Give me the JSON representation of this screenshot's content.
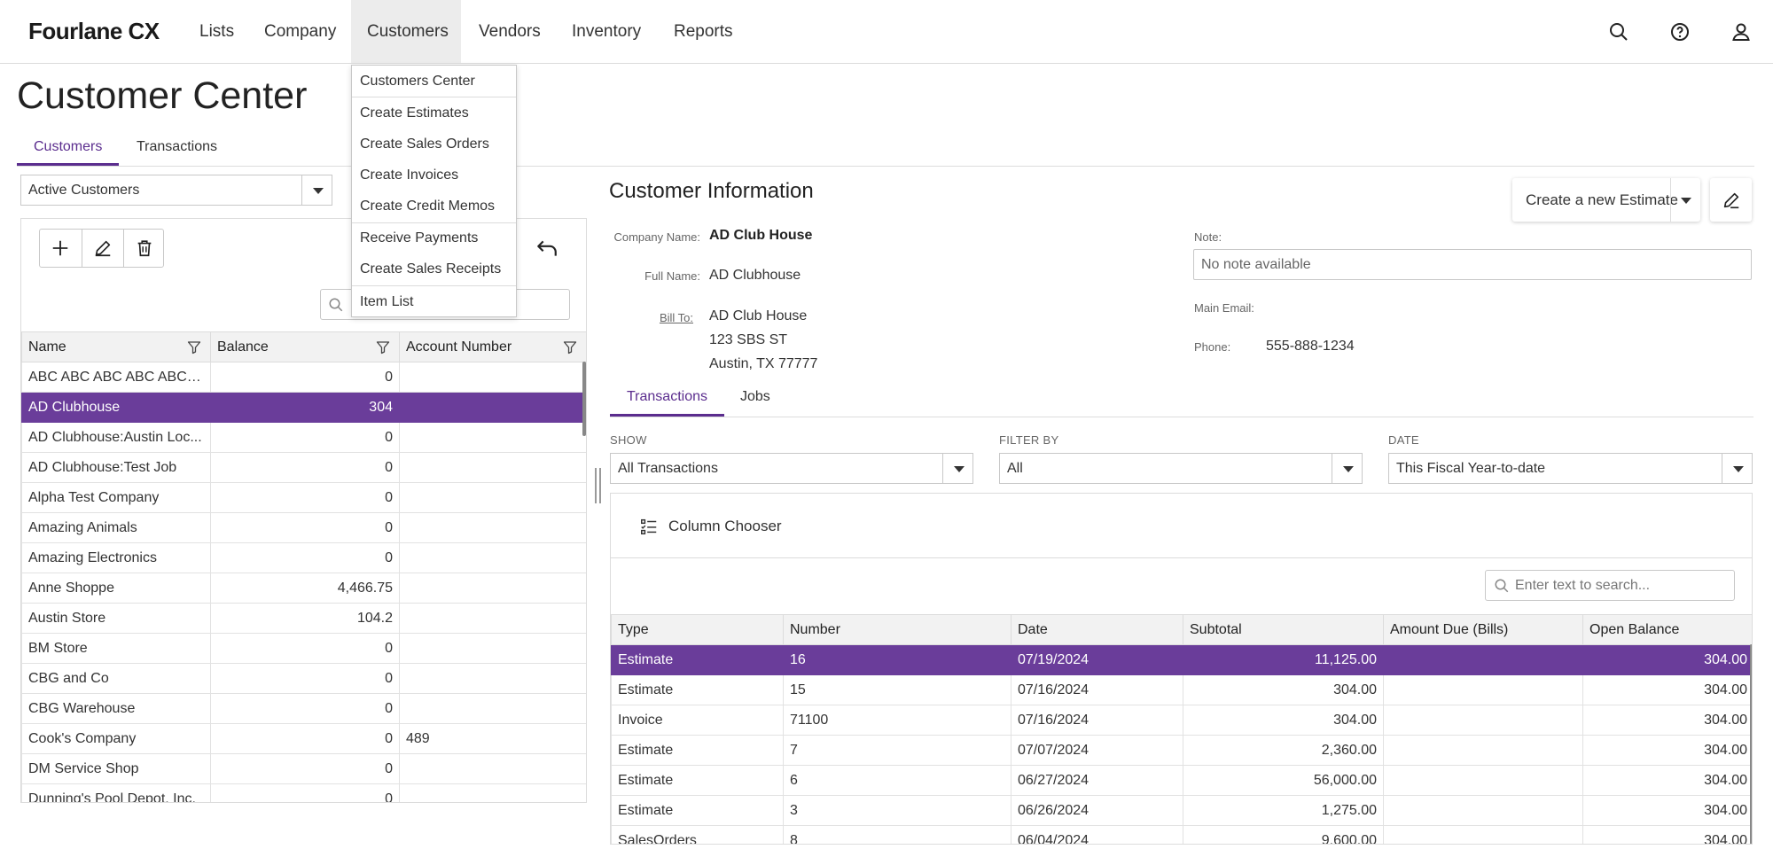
{
  "app": {
    "logo": "Fourlane CX"
  },
  "nav": {
    "items": [
      "Lists",
      "Company",
      "Customers",
      "Vendors",
      "Inventory",
      "Reports"
    ],
    "active": "Customers",
    "icons": [
      "search-icon",
      "help-icon",
      "user-icon"
    ]
  },
  "customers_menu": {
    "items": [
      "Customers Center",
      "Create Estimates",
      "Create Sales Orders",
      "Create Invoices",
      "Create Credit Memos",
      "Receive Payments",
      "Create Sales Receipts",
      "Item List"
    ]
  },
  "page": {
    "title": "Customer Center",
    "tabs": [
      "Customers",
      "Transactions"
    ],
    "active_tab": "Customers"
  },
  "left": {
    "filter_value": "Active Customers",
    "columns": [
      "Name",
      "Balance",
      "Account Number"
    ],
    "rows": [
      [
        "ABC ABC ABC ABC ABC A...",
        "0",
        ""
      ],
      [
        "AD Clubhouse",
        "304",
        ""
      ],
      [
        "AD Clubhouse:Austin Loc...",
        "0",
        ""
      ],
      [
        "AD Clubhouse:Test Job",
        "0",
        ""
      ],
      [
        "Alpha Test Company",
        "0",
        ""
      ],
      [
        "Amazing Animals",
        "0",
        ""
      ],
      [
        "Amazing Electronics",
        "0",
        ""
      ],
      [
        "Anne Shoppe",
        "4,466.75",
        ""
      ],
      [
        "Austin Store",
        "104.2",
        ""
      ],
      [
        "BM Store",
        "0",
        ""
      ],
      [
        "CBG and Co",
        "0",
        ""
      ],
      [
        "CBG Warehouse",
        "0",
        ""
      ],
      [
        "Cook's Company",
        "0",
        "489"
      ],
      [
        "DM Service Shop",
        "0",
        ""
      ],
      [
        "Dunning's Pool Depot, Inc.",
        "0",
        ""
      ]
    ],
    "selected_row": 1
  },
  "info": {
    "title": "Customer Information",
    "create_button": "Create a new Estimate",
    "labels": {
      "company": "Company Name:",
      "full": "Full Name:",
      "bill": "Bill To:",
      "note": "Note:",
      "email": "Main Email:",
      "phone": "Phone:"
    },
    "company_name": "AD Club House",
    "full_name": "AD Clubhouse",
    "bill_to": [
      "AD Club House",
      "123 SBS ST",
      "Austin, TX 77777"
    ],
    "note": "No note available",
    "main_email": "",
    "phone": "555-888-1234"
  },
  "sub": {
    "tabs": [
      "Transactions",
      "Jobs"
    ],
    "active_tab": "Transactions",
    "show_label": "SHOW",
    "show_value": "All Transactions",
    "filter_label": "FILTER BY",
    "filter_value": "All",
    "date_label": "DATE",
    "date_value": "This Fiscal Year-to-date",
    "column_chooser": "Column Chooser",
    "search_placeholder": "Enter text to search...",
    "columns": [
      "Type",
      "Number",
      "Date",
      "Subtotal",
      "Amount Due (Bills)",
      "Open Balance"
    ],
    "rows": [
      [
        "Estimate",
        "16",
        "07/19/2024",
        "11,125.00",
        "",
        "304.00"
      ],
      [
        "Estimate",
        "15",
        "07/16/2024",
        "304.00",
        "",
        "304.00"
      ],
      [
        "Invoice",
        "71100",
        "07/16/2024",
        "304.00",
        "",
        "304.00"
      ],
      [
        "Estimate",
        "7",
        "07/07/2024",
        "2,360.00",
        "",
        "304.00"
      ],
      [
        "Estimate",
        "6",
        "06/27/2024",
        "56,000.00",
        "",
        "304.00"
      ],
      [
        "Estimate",
        "3",
        "06/26/2024",
        "1,275.00",
        "",
        "304.00"
      ],
      [
        "SalesOrders",
        "8",
        "06/04/2024",
        "9,600.00",
        "",
        "304.00"
      ]
    ],
    "selected_row": 0
  },
  "colors": {
    "accent": "#5b2d8e",
    "selected_row": "#6a3d9a"
  }
}
